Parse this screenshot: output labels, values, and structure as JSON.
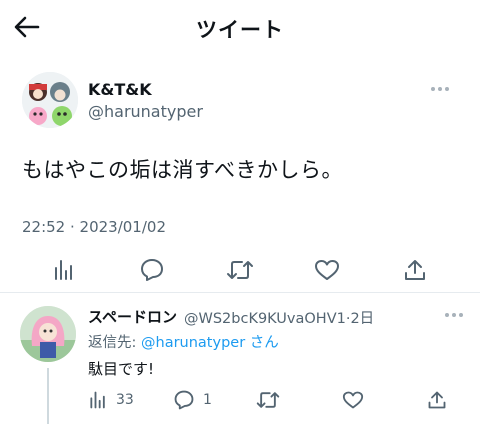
{
  "header": {
    "title": "ツイート",
    "back_icon": "arrow-left-icon"
  },
  "tweet": {
    "author_name": "K&T&K",
    "author_handle": "@harunatyper",
    "text": "もはやこの垢は消すべきかしら。",
    "timestamp": "22:52 · 2023/01/02",
    "actions": [
      "stats-icon",
      "reply-icon",
      "retweet-icon",
      "like-icon",
      "share-icon"
    ]
  },
  "reply": {
    "author_name": "スペードロン",
    "handle_and_time": "@WS2bcK9KUvaOHV1·2日",
    "reply_to_prefix": "返信先:",
    "reply_to_handle": "@harunatyper",
    "reply_to_suffix": "さん",
    "text": "駄目です!",
    "views_count": "33",
    "replies_count": "1"
  },
  "colors": {
    "text": "#0f1419",
    "secondary": "#536471",
    "link": "#1d9bf0",
    "divider": "#e6ebef"
  }
}
